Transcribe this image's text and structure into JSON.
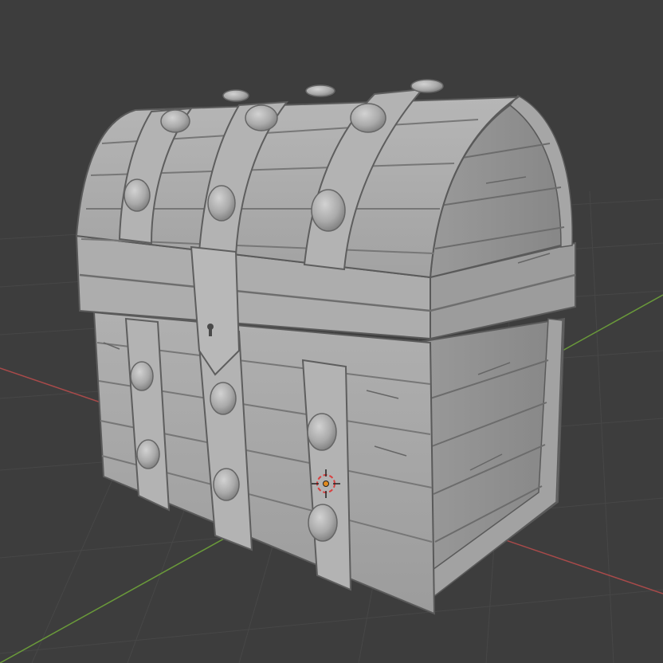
{
  "viewport": {
    "background": "#3d3d3d",
    "grid_color": "#4a4a4a",
    "x_axis_color": "#a84a4a",
    "y_axis_color": "#6a9a3a"
  },
  "model": {
    "name_icon": "treasure-chest-icon",
    "base_color": "#a6a6a6",
    "light_color": "#bdbdbd",
    "shade_color": "#8a8a8a",
    "dark_color": "#6c6c6c",
    "outline_color": "#5a5a5a"
  },
  "cursor": {
    "icon": "3d-cursor-icon",
    "ring_color": "#d94040",
    "center_color": "#e08a1e"
  }
}
